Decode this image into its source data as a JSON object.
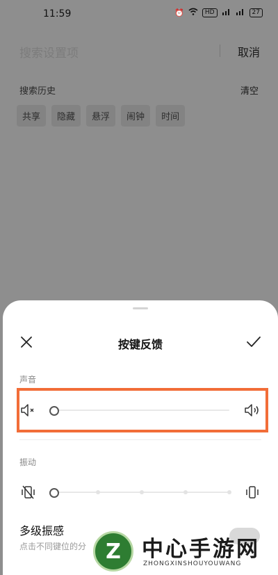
{
  "status_bar": {
    "time": "11:59",
    "battery": "27",
    "net_badge": "HD"
  },
  "search": {
    "placeholder": "搜索设置项",
    "cancel_label": "取消"
  },
  "history": {
    "title": "搜索历史",
    "clear_label": "清空",
    "chips": [
      "共享",
      "隐藏",
      "悬浮",
      "闹钟",
      "时间"
    ]
  },
  "sheet": {
    "title": "按键反馈",
    "sound_label": "声音",
    "sound_level": 0,
    "vibration_label": "振动",
    "vibration_level": 0,
    "vibration_steps": 5,
    "multi_title": "多级振感",
    "multi_sub": "点击不同键位的分"
  },
  "watermark": {
    "logo_letter": "Z",
    "text": "中心手游网",
    "sub": "ZHONGXINSHOUYOUWANG"
  },
  "colors": {
    "highlight": "#f26d38",
    "overlay": "#8e8e8e"
  }
}
